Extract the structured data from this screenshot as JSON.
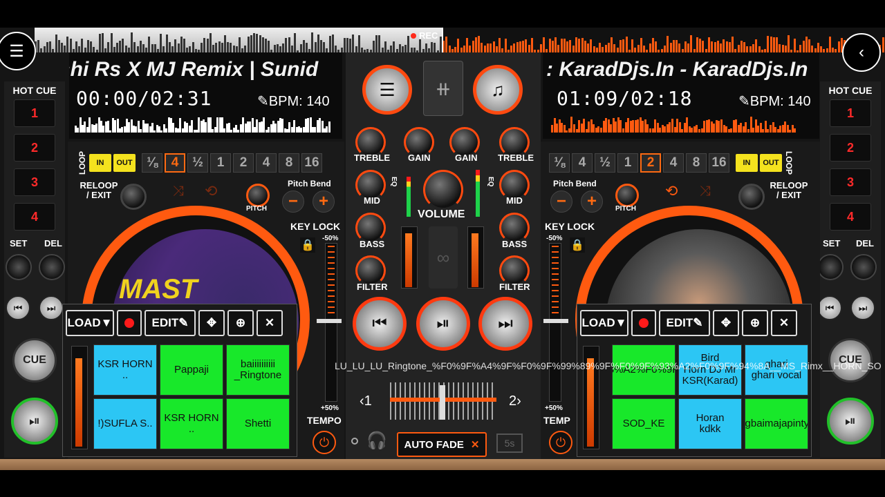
{
  "top": {
    "rec_label": "REC",
    "menu_icon": "hamburger-icon",
    "back_icon": "chevron-left-icon"
  },
  "colors": {
    "accent": "#ff5a10",
    "pad_blue": "#2cc6f4",
    "pad_green": "#18e82a",
    "inout_yellow": "#f4e21e",
    "play_ring": "#22c02a"
  },
  "deckA": {
    "title": "shi Rs X MJ Remix  | Sunid",
    "time": "00:00/02:31",
    "bpm": "BPM: 140",
    "hot_cue_title": "HOT CUE",
    "hot_cues": [
      "1",
      "2",
      "3",
      "4"
    ],
    "set_label": "SET",
    "del_label": "DEL",
    "cue_label": "CUE",
    "loop_label": "LOOP",
    "in_label": "IN",
    "out_label": "OUT",
    "beats": [
      "⅛",
      "4",
      "½",
      "1",
      "2",
      "4",
      "8",
      "16"
    ],
    "active_beat_index": 1,
    "reloop_label": "RELOOP\n/ EXIT",
    "pitch_bend_label": "Pitch Bend",
    "pitch_label": "PITCH",
    "key_lock_label": "KEY LOCK",
    "pitch_top": "-50%",
    "pitch_bottom": "+50%",
    "tempo_label": "TEMPO",
    "platter_text": "MAST",
    "sampler": {
      "load_label": "LOAD▼",
      "edit_label": "EDIT",
      "pads": [
        {
          "label": "KSR HORN ..",
          "color": "blue"
        },
        {
          "label": "Pappaji",
          "color": "green"
        },
        {
          "label": "baiiiiiiiiii\n_Ringtone",
          "color": "green"
        },
        {
          "label": "!)SUFLA S..",
          "color": "blue"
        },
        {
          "label": "KSR HORN ..",
          "color": "green"
        },
        {
          "label": "Shetti",
          "color": "green"
        }
      ]
    }
  },
  "deckB": {
    "title": ": KaradDjs.In - KaradDjs.In",
    "time": "01:09/02:18",
    "bpm": "BPM: 140",
    "hot_cue_title": "HOT CUE",
    "hot_cues": [
      "1",
      "2",
      "3",
      "4"
    ],
    "set_label": "SET",
    "del_label": "DEL",
    "cue_label": "CUE",
    "loop_label": "LOOP",
    "in_label": "IN",
    "out_label": "OUT",
    "beats": [
      "⅛",
      "4",
      "½",
      "1",
      "2",
      "4",
      "8",
      "16"
    ],
    "active_beat_index": 4,
    "reloop_label": "RELOOP\n/ EXIT",
    "pitch_bend_label": "Pitch Bend",
    "pitch_label": "PITCH",
    "key_lock_label": "KEY LOCK",
    "pitch_top": "-50%",
    "pitch_bottom": "+50%",
    "tempo_label": "TEMP",
    "sampler": {
      "load_label": "LOAD▼",
      "edit_label": "EDIT",
      "pads": [
        {
          "label": "0%9F%93%A2%F0%9F%94%8A",
          "color": "green"
        },
        {
          "label": "Bird\nHorn DJ Mr KSR(Karad)",
          "color": "blue"
        },
        {
          "label": "ghari\nghari vocal",
          "color": "blue"
        },
        {
          "label": "SOD_KE",
          "color": "green"
        },
        {
          "label": "Horan\nkdkk",
          "color": "blue"
        },
        {
          "label": "Agbaimajapintya",
          "color": "green"
        }
      ]
    }
  },
  "mixer": {
    "treble_label": "TREBLE",
    "gain_label": "GAIN",
    "mid_label": "MID",
    "bass_label": "BASS",
    "filter_label": "FILTER",
    "eq_label": "EQ",
    "volume_label": "VOLUME",
    "cross_left": "‹1",
    "cross_right": "2›",
    "autofade_label": "AUTO FADE",
    "autofade_time": "5s",
    "overflow_text": "LU_LU_LU_Ringtone_%F0%9F%A4%9F%F0%9F%99%89%9F%F0%9F%93%A2%F0%9F%94%8A__MS_Rimx__HORN_SO"
  }
}
